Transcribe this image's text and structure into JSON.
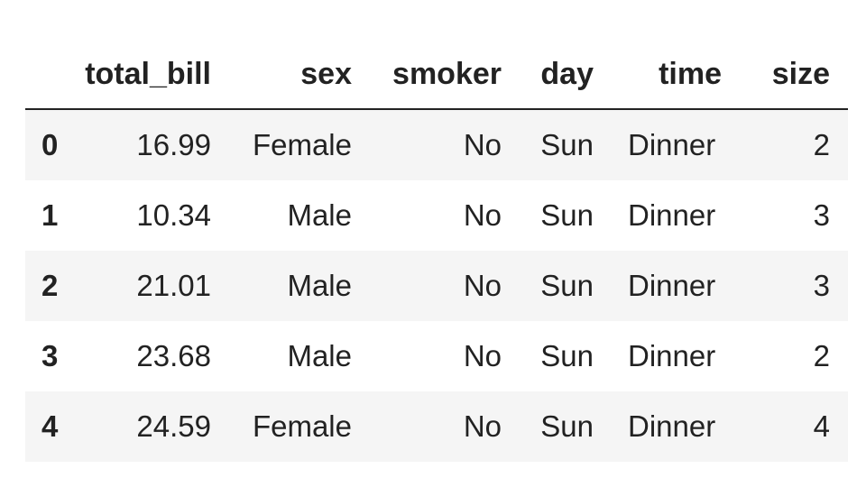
{
  "table": {
    "columns": [
      "",
      "total_bill",
      "sex",
      "smoker",
      "day",
      "time",
      "size"
    ],
    "rows": [
      {
        "index": "0",
        "total_bill": "16.99",
        "sex": "Female",
        "smoker": "No",
        "day": "Sun",
        "time": "Dinner",
        "size": "2"
      },
      {
        "index": "1",
        "total_bill": "10.34",
        "sex": "Male",
        "smoker": "No",
        "day": "Sun",
        "time": "Dinner",
        "size": "3"
      },
      {
        "index": "2",
        "total_bill": "21.01",
        "sex": "Male",
        "smoker": "No",
        "day": "Sun",
        "time": "Dinner",
        "size": "3"
      },
      {
        "index": "3",
        "total_bill": "23.68",
        "sex": "Male",
        "smoker": "No",
        "day": "Sun",
        "time": "Dinner",
        "size": "2"
      },
      {
        "index": "4",
        "total_bill": "24.59",
        "sex": "Female",
        "smoker": "No",
        "day": "Sun",
        "time": "Dinner",
        "size": "4"
      }
    ]
  },
  "colors": {
    "text": "#222222",
    "row_stripe": "#f5f5f5",
    "background": "#ffffff",
    "header_rule": "#222222"
  }
}
